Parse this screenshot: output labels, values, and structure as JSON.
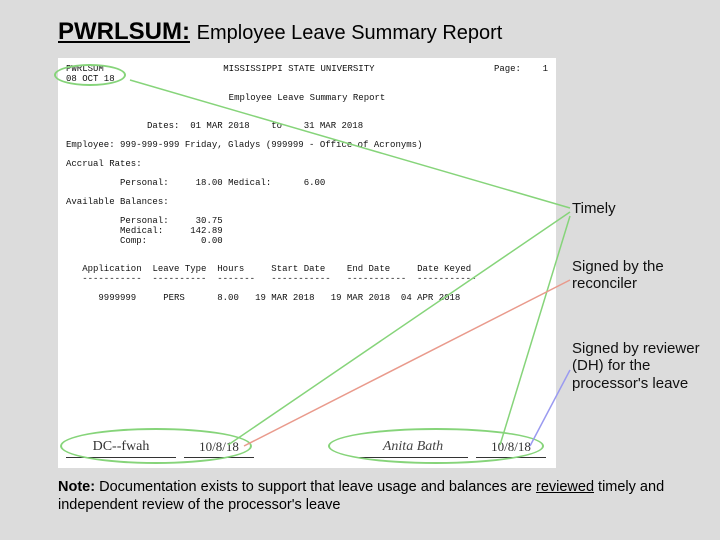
{
  "title": {
    "code": "PWRLSUM:",
    "subtitle": "Employee Leave Summary Report"
  },
  "report": {
    "code": "PWRLSUM",
    "university": "MISSISSIPPI STATE UNIVERSITY",
    "page_label": "Page:",
    "page_num": "1",
    "date_line": "08 OCT 18",
    "heading": "Employee Leave Summary Report",
    "dates_label": "Dates:",
    "date_from": "01 MAR 2018",
    "to": "to",
    "date_to": "31 MAR 2018",
    "employee_label": "Employee:",
    "employee": "999-999-999 Friday, Gladys (999999 - Office of Acronyms)",
    "accrual_label": "Accrual Rates:",
    "avail_label": "Available Balances:",
    "rows": {
      "acc_personal_lbl": "Personal:",
      "acc_personal": "18.00",
      "acc_medical_lbl": "Medical:",
      "acc_medical": "6.00",
      "bal_personal_lbl": "Personal:",
      "bal_personal": "30.75",
      "bal_medical_lbl": "Medical:",
      "bal_medical": "142.89",
      "bal_comp_lbl": "Comp:",
      "bal_comp": "0.00"
    },
    "table": {
      "h1": "Application",
      "h2": "Leave Type",
      "h3": "Hours",
      "h4": "Start Date",
      "h5": "End Date",
      "h6": "Date Keyed",
      "r_app": "9999999",
      "r_type": "PERS",
      "r_hours": "8.00",
      "r_start": "19 MAR 2018",
      "r_end": "19 MAR 2018",
      "r_keyed": "04 APR 2018"
    },
    "signatures": {
      "s1": "DC--fwah",
      "d1": "10/8/18",
      "s2": "Anita Bath",
      "d2": "10/8/18"
    }
  },
  "annotations": {
    "a1": "Timely",
    "a2": "Signed by the reconciler",
    "a3": "Signed by reviewer (DH) for the processor's leave"
  },
  "note": {
    "label": "Note:",
    "text_a": "Documentation exists to support that leave usage and balances are ",
    "text_u": "reviewed",
    "text_b": " timely and independent review of the processor's leave"
  }
}
